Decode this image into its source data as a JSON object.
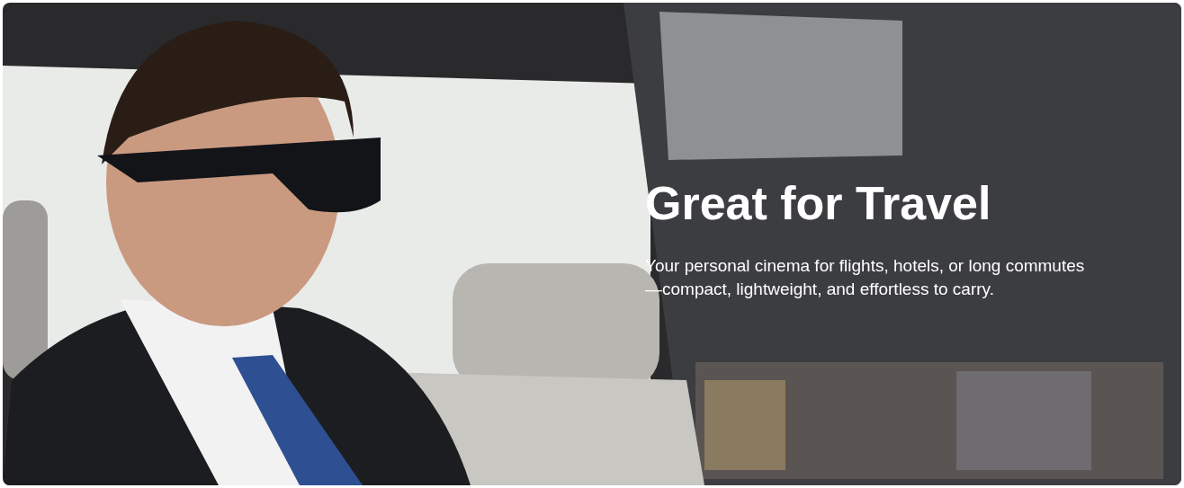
{
  "banner": {
    "title": "Great for Travel",
    "description": "Your personal cinema for flights, hotels, or long commutes—compact, lightweight, and effortless to carry."
  }
}
